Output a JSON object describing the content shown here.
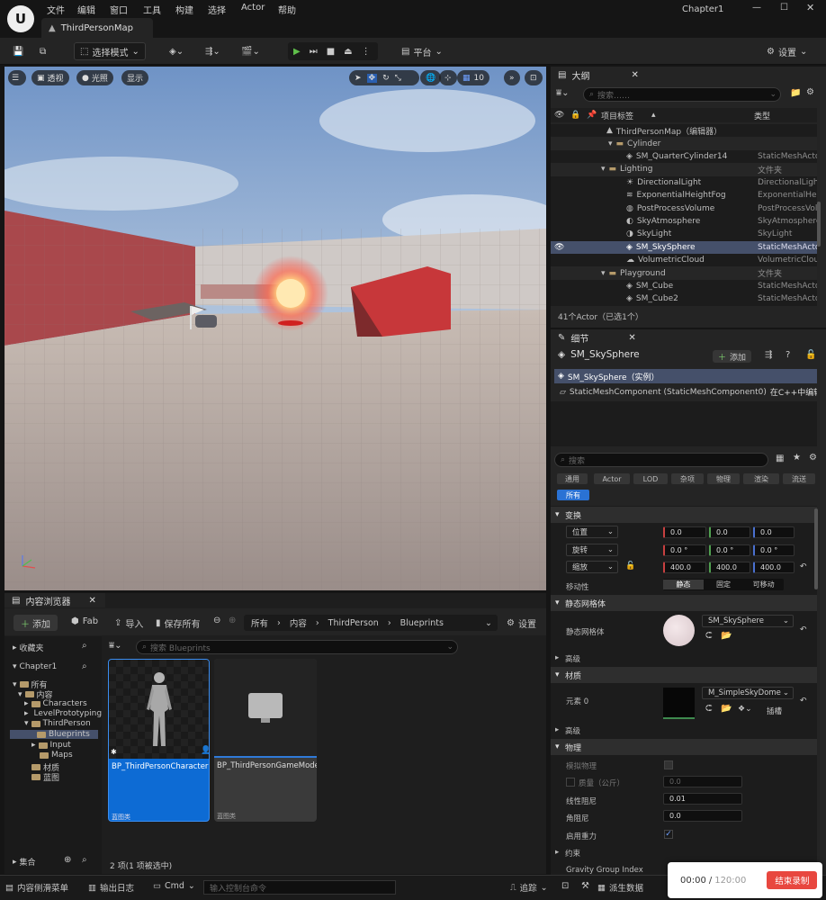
{
  "menu": [
    "文件",
    "编辑",
    "窗口",
    "工具",
    "构建",
    "选择",
    "Actor",
    "帮助"
  ],
  "project_name": "Chapter1",
  "map_tab": "ThirdPersonMap",
  "toolbar": {
    "mode_label": "选择模式",
    "platform_label": "平台",
    "settings_label": "设置"
  },
  "viewport": {
    "perspective_label": "透视",
    "lit_label": "光照",
    "show_label": "显示",
    "grid_size": "10"
  },
  "outliner": {
    "tab_label": "大纲",
    "search_placeholder": "搜索……",
    "col_label": "项目标签",
    "col_type": "类型",
    "rows": [
      {
        "name": "ThirdPersonMap（编辑器）",
        "type": ""
      },
      {
        "name": "Cylinder",
        "type": ""
      },
      {
        "name": "SM_QuarterCylinder14",
        "type": "StaticMeshActor"
      },
      {
        "name": "Lighting",
        "type": "文件夹"
      },
      {
        "name": "DirectionalLight",
        "type": "DirectionalLight"
      },
      {
        "name": "ExponentialHeightFog",
        "type": "ExponentialHeightFog"
      },
      {
        "name": "PostProcessVolume",
        "type": "PostProcessVolume"
      },
      {
        "name": "SkyAtmosphere",
        "type": "SkyAtmosphere"
      },
      {
        "name": "SkyLight",
        "type": "SkyLight"
      },
      {
        "name": "SM_SkySphere",
        "type": "StaticMeshActor"
      },
      {
        "name": "VolumetricCloud",
        "type": "VolumetricCloud"
      },
      {
        "name": "Playground",
        "type": "文件夹"
      },
      {
        "name": "SM_Cube",
        "type": "StaticMeshActor"
      },
      {
        "name": "SM_Cube2",
        "type": "StaticMeshActor"
      }
    ],
    "status": "41个Actor（已选1个）"
  },
  "details": {
    "tab_label": "细节",
    "actor_name": "SM_SkySphere",
    "add_label": "添加",
    "instance_label": "SM_SkySphere（实例）",
    "component_label": "StaticMeshComponent (StaticMeshComponent0)",
    "component_note": "在C++中编辑",
    "search_placeholder": "搜索",
    "filters": [
      "通用",
      "Actor",
      "LOD",
      "杂项",
      "物理",
      "渲染",
      "流送",
      "所有"
    ],
    "transform": {
      "section": "变换",
      "location_label": "位置",
      "location": [
        "0.0",
        "0.0",
        "0.0"
      ],
      "rotation_label": "旋转",
      "rotation": [
        "0.0 °",
        "0.0 °",
        "0.0 °"
      ],
      "scale_label": "缩放",
      "scale": [
        "400.0",
        "400.0",
        "400.0"
      ],
      "mobility_label": "移动性",
      "mobility_options": [
        "静态",
        "固定",
        "可移动"
      ]
    },
    "static_mesh": {
      "section": "静态网格体",
      "label": "静态网格体",
      "value": "SM_SkySphere"
    },
    "advanced_label": "高级",
    "materials": {
      "section": "材质",
      "element_label": "元素 0",
      "value": "M_SimpleSkyDome",
      "insert_label": "插槽"
    },
    "physics": {
      "section": "物理",
      "simulate_label": "模拟物理",
      "mass_label": "质量（公斤）",
      "mass_value": "0.0",
      "linear_damping_label": "线性阻尼",
      "linear_damping": "0.01",
      "angular_damping_label": "角阻尼",
      "angular_damping": "0.0",
      "gravity_label": "启用重力",
      "constraints_label": "约束",
      "gravity_group_label": "Gravity Group Index"
    }
  },
  "content_browser": {
    "tab_label": "内容浏览器",
    "add_label": "添加",
    "fab_label": "Fab",
    "import_label": "导入",
    "save_all_label": "保存所有",
    "breadcrumb": [
      "所有",
      "内容",
      "ThirdPerson",
      "Blueprints"
    ],
    "settings_label": "设置",
    "favorites_label": "收藏夹",
    "project_label": "Chapter1",
    "tree": [
      "所有",
      "内容",
      "Characters",
      "LevelPrototyping",
      "ThirdPerson",
      "Blueprints",
      "Input",
      "Maps",
      "材质",
      "蓝图"
    ],
    "collections_label": "集合",
    "search_placeholder": "搜索 Blueprints",
    "assets": [
      {
        "name": "BP_ThirdPersonCharacter",
        "type": "蓝图类"
      },
      {
        "name": "BP_ThirdPersonGameMode",
        "type": "蓝图类"
      }
    ],
    "status": "2 项(1 项被选中)"
  },
  "bottom": {
    "drawer_label": "内容侧滑菜单",
    "output_label": "输出日志",
    "cmd_label": "Cmd",
    "cmd_placeholder": "输入控制台命令",
    "trace_label": "追踪",
    "derived_label": "派生数据"
  },
  "recording": {
    "elapsed": "00:00",
    "separator": "/",
    "total": "120:00",
    "stop_label": "结束录制",
    "stop_color": "#e8473f"
  }
}
